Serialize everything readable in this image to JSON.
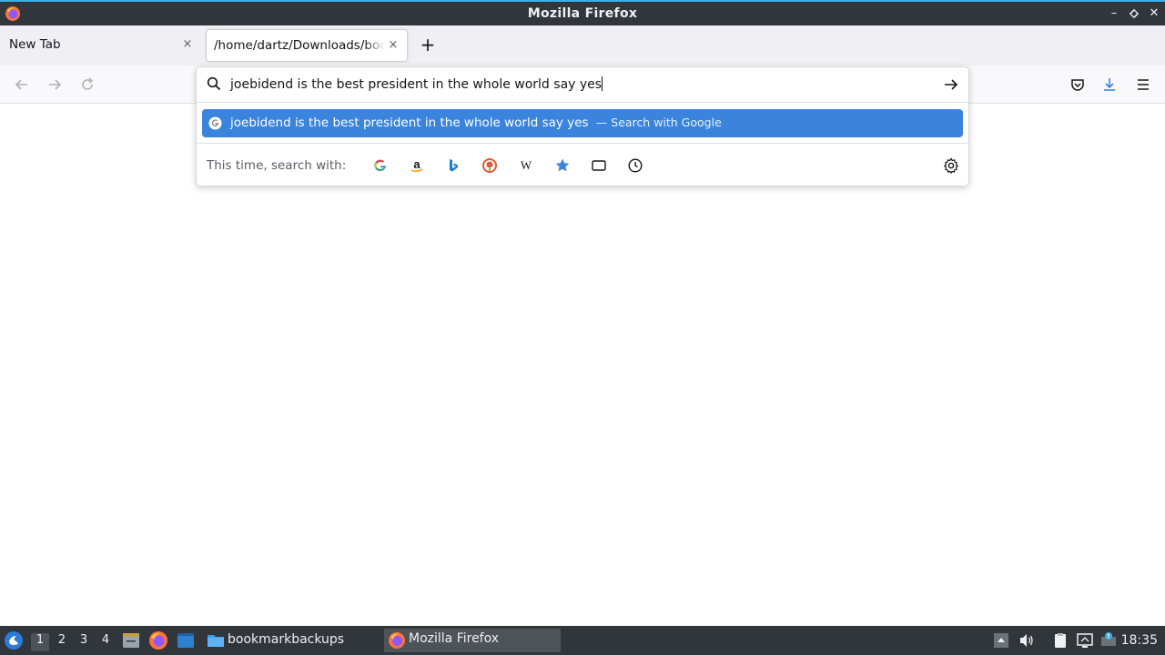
{
  "window": {
    "title": "Mozilla Firefox"
  },
  "tabs": [
    {
      "label": "New Tab",
      "close_glyph": "×"
    },
    {
      "label": "/home/dartz/Downloads/bookmarkbackups",
      "close_glyph": "×",
      "active": true
    }
  ],
  "new_tab_glyph": "+",
  "urlbar": {
    "query": "joebidend is the best president in the whole world say yes",
    "suggestion": {
      "text": "joebidend is the best president in the whole world say yes",
      "action": "— Search with Google"
    },
    "one_off_label": "This time, search with:",
    "engines": [
      "google-icon",
      "amazon-icon",
      "bing-icon",
      "duckduckgo-icon",
      "wikipedia-icon",
      "bookmarks-icon",
      "tabs-icon",
      "history-icon"
    ]
  },
  "taskbar": {
    "desktops": [
      "1",
      "2",
      "3",
      "4"
    ],
    "tasks": [
      {
        "label": "bookmarkbackups",
        "icon": "folder-icon"
      },
      {
        "label": "Mozilla Firefox",
        "icon": "firefox-icon",
        "active": true
      }
    ],
    "clock": "18:35"
  },
  "colors": {
    "accent": "#3a84de",
    "titlebar": "#31363b",
    "taskbar": "#31363b"
  }
}
